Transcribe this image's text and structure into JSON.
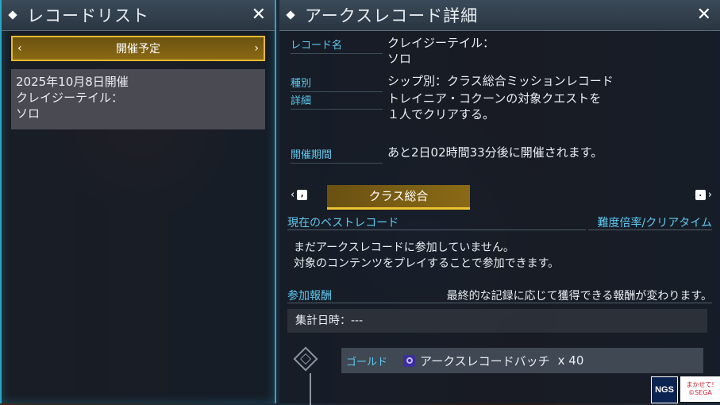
{
  "left_panel": {
    "title": "レコードリスト",
    "close_glyph": "✕",
    "upcoming": {
      "label": "開催予定",
      "prev_glyph": "‹",
      "next_glyph": "›"
    },
    "record": {
      "date": "2025年10月8日開催",
      "name_line1": "クレイジーテイル：",
      "name_line2": "ソロ"
    }
  },
  "right_panel": {
    "title": "アークスレコード詳細",
    "close_glyph": "✕",
    "fields": {
      "record_name_label": "レコード名",
      "record_name_line1": "クレイジーテイル：",
      "record_name_line2": "ソロ",
      "type_label": "種別",
      "type_value": "シップ別：クラス総合ミッションレコード",
      "detail_label": "詳細",
      "detail_line1": "トレイニア・コクーンの対象クエストを",
      "detail_line2": "１人でクリアする。",
      "period_label": "開催期間",
      "period_value": "あと2日02時間33分後に開催されます。"
    },
    "tabs": {
      "left_key": ",",
      "right_key": ".",
      "active": "クラス総合"
    },
    "best_record": {
      "heading": "現在のベストレコード",
      "side_heading": "難度倍率/クリアタイム",
      "message_line1": "まだアークスレコードに参加していません。",
      "message_line2": "対象のコンテンツをプレイすることで参加できます。"
    },
    "rewards": {
      "heading": "参加報酬",
      "note": "最終的な記録に応じて獲得できる報酬が変わります。",
      "aggregate": "集計日時：---",
      "tier_label": "ゴールド",
      "item": "アークスレコードバッチ",
      "quantity": "x 40"
    }
  },
  "logos": {
    "ngs": "NGS",
    "sega_line1": "まかせて!",
    "sega_line2": "©SEGA"
  },
  "colors": {
    "accent_cyan": "#5fc8f0",
    "accent_gold": "#f0c431",
    "border_cyan": "#2aa6c4"
  }
}
